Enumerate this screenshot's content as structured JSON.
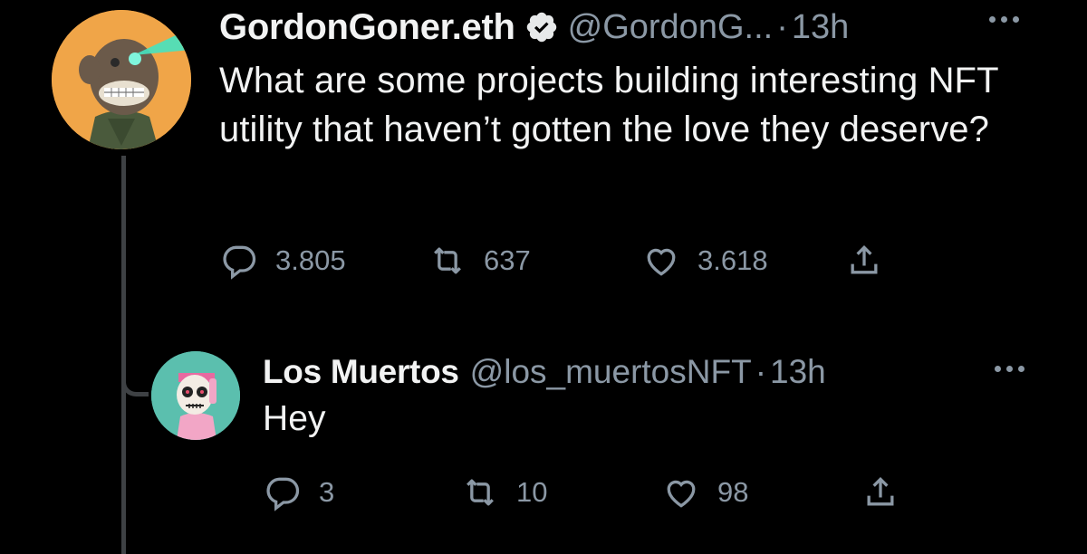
{
  "colors": {
    "background": "#000000",
    "text": "#f2f3f3",
    "secondary": "#8b98a5",
    "thread_line": "#3e4144",
    "verified": "#e7e9ea"
  },
  "main_tweet": {
    "display_name": "GordonGoner.eth",
    "verified": true,
    "handle": "@GordonG...",
    "separator": "·",
    "time": "13h",
    "text": "What are some projects building interesting NFT utility that haven’t gotten the love they deserve?",
    "avatar_icon": "bored-ape-laser-eyes-avatar",
    "actions": {
      "reply_count": "3.805",
      "retweet_count": "637",
      "like_count": "3.618"
    }
  },
  "reply_tweet": {
    "display_name": "Los Muertos",
    "handle": "@los_muertosNFT",
    "separator": "·",
    "time": "13h",
    "text": "Hey",
    "avatar_icon": "skull-character-avatar",
    "actions": {
      "reply_count": "3",
      "retweet_count": "10",
      "like_count": "98"
    }
  }
}
